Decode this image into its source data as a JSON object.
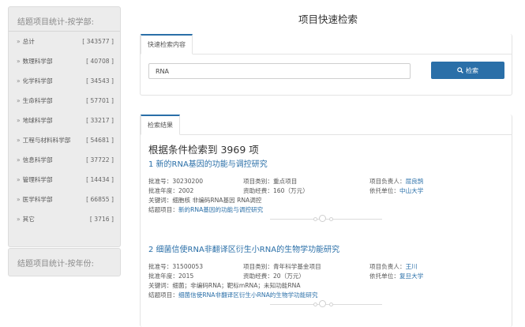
{
  "sidebar": {
    "subject_title": "结题项目统计-按学部:",
    "year_title": "结题项目统计-按年份:",
    "items": [
      {
        "label": "总计",
        "count": "[ 343577 ]"
      },
      {
        "label": "数理科学部",
        "count": "[ 40708 ]"
      },
      {
        "label": "化学科学部",
        "count": "[ 34543 ]"
      },
      {
        "label": "生命科学部",
        "count": "[ 57701 ]"
      },
      {
        "label": "地球科学部",
        "count": "[ 33217 ]"
      },
      {
        "label": "工程与材料科学部",
        "count": "[ 54681 ]"
      },
      {
        "label": "信息科学部",
        "count": "[ 37722 ]"
      },
      {
        "label": "管理科学部",
        "count": "[ 14434 ]"
      },
      {
        "label": "医学科学部",
        "count": "[ 66855 ]"
      },
      {
        "label": "其它",
        "count": "[ 3716 ]"
      }
    ]
  },
  "main": {
    "title": "项目快速检索",
    "search_tab": "快速检索内容",
    "search_value": "RNA",
    "search_button": "检索",
    "results_tab": "检索结果",
    "result_heading": "根据条件检索到 3969 项"
  },
  "results": [
    {
      "title": "1 新的RNA基因的功能与调控研究",
      "approval_label": "批准号：",
      "approval": "30230200",
      "type_label": "项目类别：",
      "type": "重点项目",
      "leader_label": "项目负责人：",
      "leader": "屈良鹄",
      "year_label": "批准年度：",
      "year": "2002",
      "funding_label": "资助经费：",
      "funding": "160（万元）",
      "org_label": "依托单位：",
      "org": "中山大学",
      "keywords_label": "关键词：",
      "keywords": "细胞核 非编码RNA基因 RNA调控",
      "report_label": "结题项目：",
      "report": "新的RNA基因的功能与调控研究"
    },
    {
      "title": "2 细菌信使RNA非翻译区衍生小RNA的生物学功能研究",
      "approval_label": "批准号：",
      "approval": "31500053",
      "type_label": "项目类别：",
      "type": "青年科学基金项目",
      "leader_label": "项目负责人：",
      "leader": "王川",
      "year_label": "批准年度：",
      "year": "2015",
      "funding_label": "资助经费：",
      "funding": "20（万元）",
      "org_label": "依托单位：",
      "org": "复旦大学",
      "keywords_label": "关键词：",
      "keywords": "细菌；非编码RNA；靶标mRNA；未知功能RNA",
      "report_label": "结题项目：",
      "report": "细菌信使RNA非翻译区衍生小RNA的生物学功能研究"
    }
  ],
  "icons": {
    "arrow": "double-chevron-right-icon",
    "search": "magnifier-icon"
  },
  "colors": {
    "accent": "#2a6fa8",
    "panel_bg": "#ececec"
  }
}
